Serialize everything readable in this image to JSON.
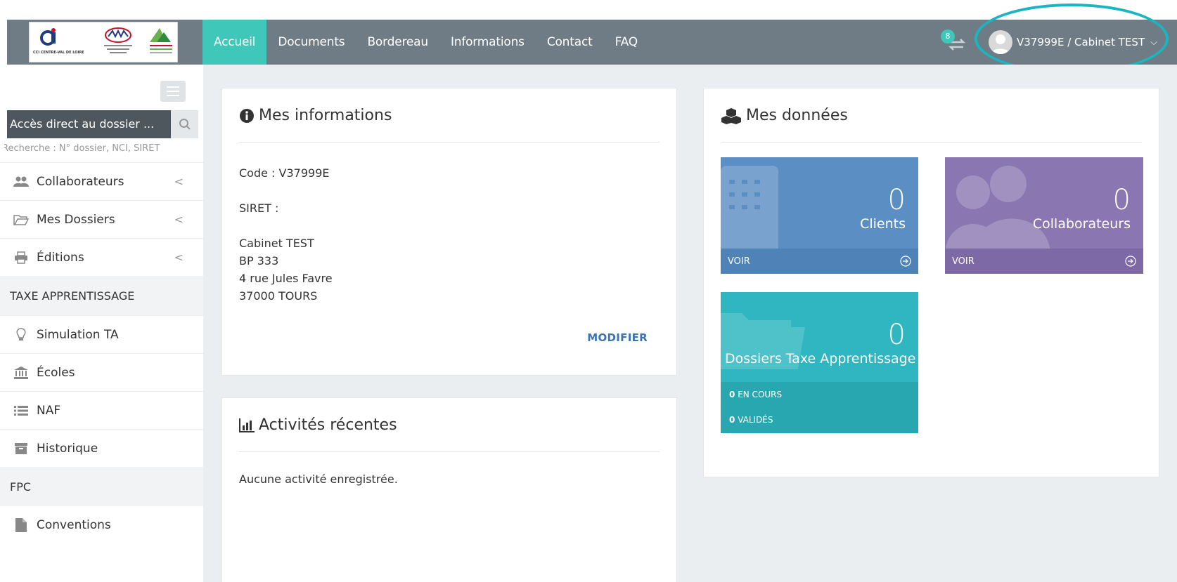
{
  "nav": {
    "items": [
      {
        "label": "Accueil"
      },
      {
        "label": "Documents"
      },
      {
        "label": "Bordereau"
      },
      {
        "label": "Informations"
      },
      {
        "label": "Contact"
      },
      {
        "label": "FAQ"
      }
    ],
    "active": "Accueil",
    "notification_count": "8",
    "user_label": "V37999E / Cabinet TEST"
  },
  "logos": {
    "cci_text": "CCI CENTRE-VAL DE LOIRE"
  },
  "sidebar": {
    "search_placeholder": "Accès direct au dossier ...",
    "search_hint": "Recherche : N° dossier, NCI, SIRET",
    "items": [
      {
        "label": "Collaborateurs",
        "icon": "users-icon"
      },
      {
        "label": "Mes Dossiers",
        "icon": "folder-open-icon"
      },
      {
        "label": "Éditions",
        "icon": "print-icon"
      }
    ],
    "section_ta": "TAXE APPRENTISSAGE",
    "ta_items": [
      {
        "label": "Simulation TA",
        "icon": "lightbulb-icon"
      },
      {
        "label": "Écoles",
        "icon": "bank-icon"
      },
      {
        "label": "NAF",
        "icon": "list-icon"
      },
      {
        "label": "Historique",
        "icon": "archive-icon"
      }
    ],
    "section_fpc": "FPC",
    "fpc_items": [
      {
        "label": "Conventions",
        "icon": "file-icon"
      }
    ]
  },
  "info_panel": {
    "title": "Mes informations",
    "code": "Code : V37999E",
    "siret": "SIRET :",
    "address": [
      "Cabinet TEST",
      "BP 333",
      "4 rue Jules Favre",
      "37000 TOURS"
    ],
    "modify_label": "MODIFIER"
  },
  "activity_panel": {
    "title": "Activités récentes",
    "empty": "Aucune activité enregistrée."
  },
  "data_panel": {
    "title": "Mes données",
    "tiles": {
      "clients": {
        "value": "0",
        "label": "Clients",
        "link": "VOIR"
      },
      "collaborateurs": {
        "value": "0",
        "label": "Collaborateurs",
        "link": "VOIR"
      },
      "dossiers": {
        "value": "0",
        "label": "Dossiers Taxe Apprentissage",
        "en_cours_count": "0",
        "en_cours_label": "EN COURS",
        "valides_count": "0",
        "valides_label": "VALIDÉS"
      }
    }
  },
  "colors": {
    "topbar": "#6f7b85",
    "accent": "#3fc7b9",
    "tile_blue": "#5b8fc4",
    "tile_purple": "#8a76b0",
    "tile_teal": "#2fb6c0",
    "highlight": "#1ab6c0"
  }
}
